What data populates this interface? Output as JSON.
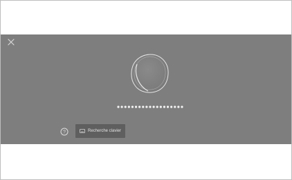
{
  "password_dialog": {
    "masked_password": "•••••••••••••••••••",
    "search_keyboard_label": "Recherche clavier"
  },
  "icons": {
    "close": "close-icon",
    "orb": "orb-icon",
    "help": "help-icon",
    "keyboard": "keyboard-icon"
  },
  "colors": {
    "overlay": "#7e7e7e",
    "button": "#5f5f5f",
    "text": "#e3e3e3"
  }
}
